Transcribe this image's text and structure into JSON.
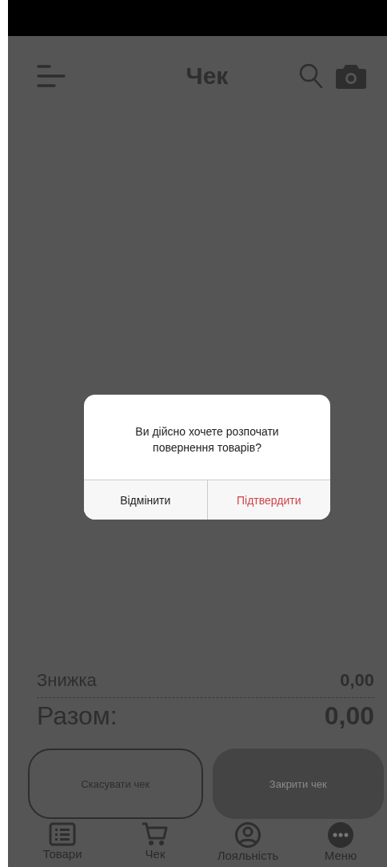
{
  "header": {
    "title": "Чек"
  },
  "dialog": {
    "message": "Ви дійсно хочете розпочати повернення товарів?",
    "buttons": [
      {
        "label": "Відмінити",
        "kind": "cancel"
      },
      {
        "label": "Підтвердити",
        "kind": "confirm"
      }
    ]
  },
  "summary": {
    "discount_label": "Знижка",
    "discount_value": "0,00",
    "total_label": "Разом:",
    "total_value": "0,00"
  },
  "actions": [
    {
      "label": "Скасувати чек",
      "kind": "outline"
    },
    {
      "label": "Закрити чек",
      "kind": "filled"
    }
  ],
  "nav": [
    {
      "label": "Товари",
      "kind": "list"
    },
    {
      "label": "Чек",
      "kind": "cart"
    },
    {
      "label": "Лояльність",
      "kind": "person"
    },
    {
      "label": "Меню",
      "kind": "more"
    }
  ]
}
